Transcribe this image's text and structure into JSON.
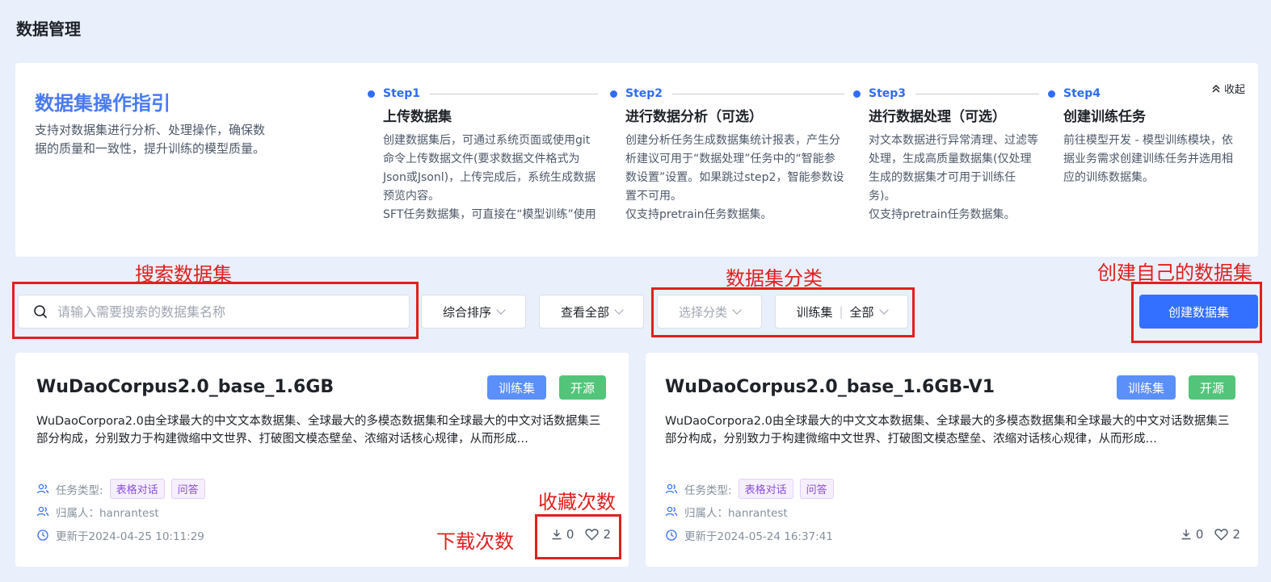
{
  "page": {
    "title": "数据管理"
  },
  "guide": {
    "title": "数据集操作指引",
    "description": "支持对数据集进行分析、处理操作，确保数据的质量和一致性，提升训练的模型质量。",
    "collapse_label": "收起",
    "steps": [
      {
        "label": "Step1",
        "title": "上传数据集",
        "body": [
          "创建数据集后，可通过系统页面或使用git命令上传数据文件(要求数据文件格式为Json或Jsonl)，上传完成后，系统生成数据预览内容。",
          "SFT任务数据集，可直接在“模型训练”使用"
        ]
      },
      {
        "label": "Step2",
        "title": "进行数据分析（可选）",
        "body": [
          "创建分析任务生成数据集统计报表，产生分析建议可用于“数据处理”任务中的“智能参数设置”设置。如果跳过step2，智能参数设置不可用。",
          "仅支持pretrain任务数据集。"
        ]
      },
      {
        "label": "Step3",
        "title": "进行数据处理（可选）",
        "body": [
          "对文本数据进行异常清理、过滤等处理，生成高质量数据集(仅处理生成的数据集才可用于训练任务)。",
          "仅支持pretrain任务数据集。"
        ]
      },
      {
        "label": "Step4",
        "title": "创建训练任务",
        "body": [
          "前往模型开发 - 模型训练模块，依据业务需求创建训练任务并选用相应的训练数据集。"
        ]
      }
    ]
  },
  "toolbar": {
    "search_placeholder": "请输入需要搜索的数据集名称",
    "sort_label": "综合排序",
    "view_label": "查看全部",
    "category_placeholder": "选择分类",
    "type_label": "训练集",
    "type_value": "全部",
    "create_label": "创建数据集"
  },
  "annotations": {
    "search": "搜索数据集",
    "category": "数据集分类",
    "create": "创建自己的数据集",
    "favorites": "收藏次数",
    "downloads": "下载次数"
  },
  "cards": [
    {
      "title": "WuDaoCorpus2.0_base_1.6GB",
      "tag_type": "训练集",
      "tag_license": "开源",
      "description": "WuDaoCorpora2.0由全球最大的中文文本数据集、全球最大的多模态数据集和全球最大的中文对话数据集三部分构成，分别致力于构建微缩中文世界、打破图文模态壁垒、浓缩对话核心规律，从而形成…",
      "task_label": "任务类型:",
      "task_tags": [
        "表格对话",
        "问答"
      ],
      "owner": "归属人：hanrantest",
      "updated": "更新于2024-04-25 10:11:29",
      "downloads": "0",
      "likes": "2"
    },
    {
      "title": "WuDaoCorpus2.0_base_1.6GB-V1",
      "tag_type": "训练集",
      "tag_license": "开源",
      "description": "WuDaoCorpora2.0由全球最大的中文文本数据集、全球最大的多模态数据集和全球最大的中文对话数据集三部分构成，分别致力于构建微缩中文世界、打破图文模态壁垒、浓缩对话核心规律，从而形成…",
      "task_label": "任务类型:",
      "task_tags": [
        "表格对话",
        "问答"
      ],
      "owner": "归属人：hanrantest",
      "updated": "更新于2024-05-24 16:37:41",
      "downloads": "0",
      "likes": "2"
    }
  ],
  "colors": {
    "background": "#e9effb",
    "accent": "#3370ff",
    "annotation": "#e02020",
    "tag_train": "#5b8ff9",
    "tag_open": "#52c57a"
  },
  "icons": [
    "search-icon",
    "chevron-down-icon",
    "chevron-up-icon",
    "users-icon",
    "clock-icon",
    "download-icon",
    "heart-icon"
  ]
}
